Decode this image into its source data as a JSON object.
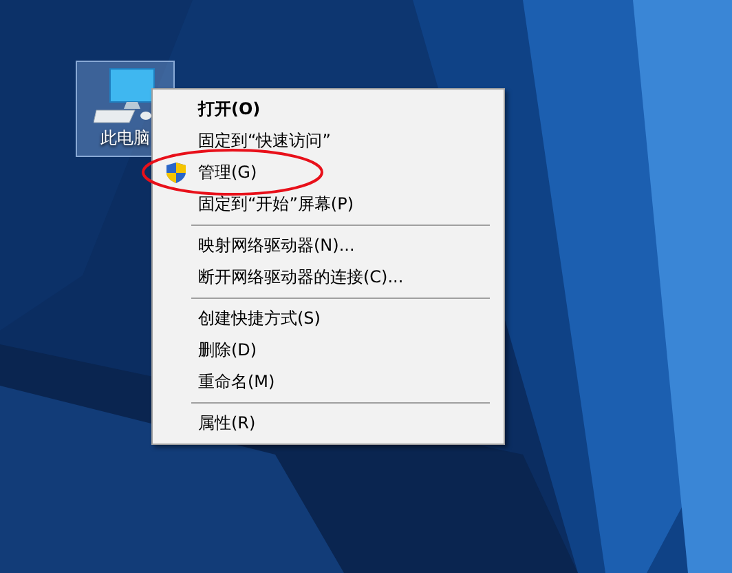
{
  "desktop_icons": [
    {
      "label": "此电脑",
      "selected": true
    }
  ],
  "context_menu": {
    "items": [
      {
        "kind": "item",
        "label": "打开(O)",
        "default": true,
        "highlighted": false
      },
      {
        "kind": "item",
        "label": "固定到“快速访问”",
        "default": false,
        "highlighted": false
      },
      {
        "kind": "admin-item",
        "label": "管理(G)",
        "default": false,
        "highlighted": true
      },
      {
        "kind": "item",
        "label": "固定到“开始”屏幕(P)",
        "default": false,
        "highlighted": false
      },
      {
        "kind": "separator"
      },
      {
        "kind": "item",
        "label": "映射网络驱动器(N)...",
        "default": false,
        "highlighted": false
      },
      {
        "kind": "item",
        "label": "断开网络驱动器的连接(C)...",
        "default": false,
        "highlighted": false
      },
      {
        "kind": "separator"
      },
      {
        "kind": "item",
        "label": "创建快捷方式(S)",
        "default": false,
        "highlighted": false
      },
      {
        "kind": "item",
        "label": "删除(D)",
        "default": false,
        "highlighted": false
      },
      {
        "kind": "item",
        "label": "重命名(M)",
        "default": false,
        "highlighted": false
      },
      {
        "kind": "separator"
      },
      {
        "kind": "item",
        "label": "属性(R)",
        "default": false,
        "highlighted": false
      }
    ]
  }
}
